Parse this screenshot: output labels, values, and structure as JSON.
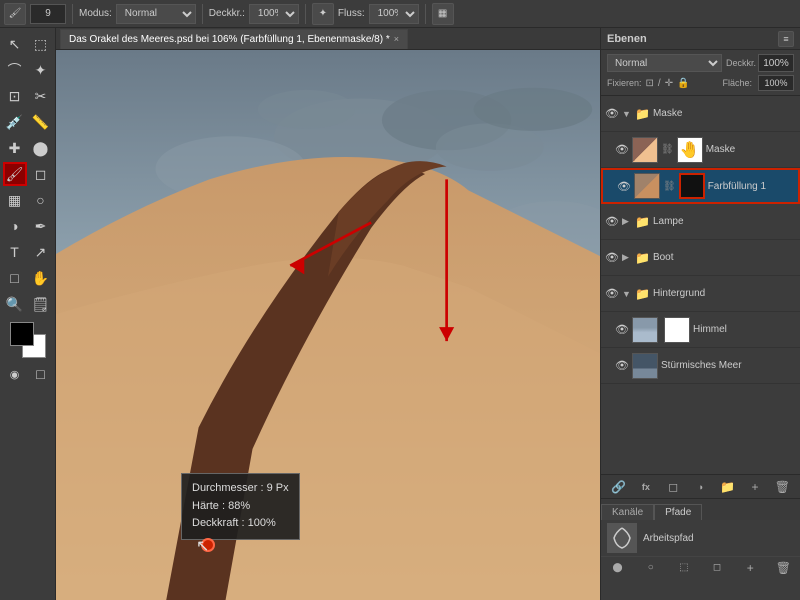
{
  "app": {
    "title": "Das Orakel des Meeres.psd"
  },
  "toolbar": {
    "brush_size": "9",
    "modus_label": "Modus:",
    "modus_value": "Normal",
    "deckk_label": "Deckkr.:",
    "deckk_value": "100%",
    "fluss_label": "Fluss:",
    "fluss_value": "100%"
  },
  "tab": {
    "label": "Das Orakel des Meeres.psd bei 106% (Farbfüllung 1, Ebenenmaske/8) *",
    "close": "×"
  },
  "layers_panel": {
    "title": "Ebenen",
    "blend_mode": "Normal",
    "opacity_label": "Deckkr.",
    "fix_label": "Fixieren:",
    "fill_label": "Fläche:",
    "layers": [
      {
        "name": "Maske",
        "type": "group",
        "visible": true,
        "expanded": true,
        "thumb": "maske",
        "mask_thumb": "white"
      },
      {
        "name": "Maske",
        "type": "layer",
        "visible": true,
        "indent": 1,
        "thumb": "maske",
        "mask_thumb": "white",
        "link": true
      },
      {
        "name": "Farbfüllung 1",
        "type": "layer",
        "visible": true,
        "indent": 1,
        "thumb": "farbfull",
        "mask_thumb": "black",
        "active": true,
        "link": true
      },
      {
        "name": "Lampe",
        "type": "group",
        "visible": true,
        "expanded": false
      },
      {
        "name": "Boot",
        "type": "group",
        "visible": true,
        "expanded": false
      },
      {
        "name": "Hintergrund",
        "type": "group",
        "visible": true,
        "expanded": true
      },
      {
        "name": "Himmel",
        "type": "layer",
        "visible": true,
        "indent": 1,
        "thumb": "himmel",
        "mask_thumb": null
      },
      {
        "name": "Stürmisches Meer",
        "type": "layer",
        "visible": true,
        "indent": 1,
        "thumb": "meer",
        "mask_thumb": null
      }
    ],
    "bottom_icons": [
      "fx",
      "⊕",
      "◻",
      "🗑"
    ]
  },
  "panel_tabs": [
    {
      "label": "Kanäle",
      "active": false
    },
    {
      "label": "Pfade",
      "active": true
    }
  ],
  "path_panel": {
    "path_name": "Arbeitspfad"
  },
  "brush_tooltip": {
    "diameter_label": "Durchmesser :",
    "diameter_value": "9 Px",
    "hardness_label": "Härte :",
    "hardness_value": "88%",
    "opacity_label": "Deckkraft :",
    "opacity_value": "100%"
  },
  "colors": {
    "accent_blue": "#1a6496",
    "accent_red": "#cc2200",
    "active_layer_bg": "#1a4a6a",
    "active_layer_border": "#3a7ab8",
    "highlight_border": "#cc2200",
    "sky_top": "#7a8a9a",
    "sky_bottom": "#c5cfce",
    "sand_color": "#d4a980",
    "brown_stripe": "#5a3320"
  }
}
